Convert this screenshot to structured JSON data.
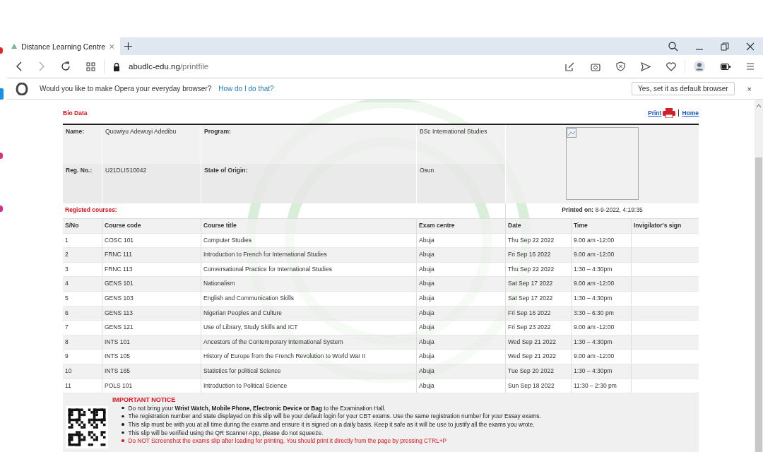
{
  "browser": {
    "tab": {
      "title": "Distance Learning Centre",
      "selected": true
    },
    "url": {
      "domain": "abudlc-edu.ng",
      "path": "/printfile"
    },
    "infobar": {
      "message": "Would you like to make Opera your everyday browser?",
      "link": "How do I do that?",
      "button": "Yes, set it as default browser",
      "close": "×"
    }
  },
  "page": {
    "bio_title": "Bio Data",
    "print_link": "Print",
    "home_link": "Home",
    "bio": [
      {
        "label": "Name:",
        "value": "Quowiyu Adewuyi Adedibu",
        "label2": "Program:",
        "value2": "BSc International Studies"
      },
      {
        "label": "Reg. No.:",
        "value": "U21DLIS10042",
        "label2": "State of Origin:",
        "value2": "Osun"
      }
    ],
    "courses_title": "Registed courses:",
    "printed_label": "Printed on:",
    "printed_value": "8-9-2022, 4:19:35",
    "columns": [
      "S/No",
      "Course code",
      "Course title",
      "Exam centre",
      "Date",
      "Time",
      "Invigilator's sign"
    ],
    "rows": [
      [
        "1",
        "COSC 101",
        "Computer Studies",
        "Abuja",
        "Thu Sep 22 2022",
        "9.00 am -12:00"
      ],
      [
        "2",
        "FRNC 111",
        "Introduction to French for International Studies",
        "Abuja",
        "Fri Sep 16 2022",
        "9.00 am -12:00"
      ],
      [
        "3",
        "FRNC 113",
        "Conversational Practice for International Studies",
        "Abuja",
        "Thu Sep 22 2022",
        "1:30 – 4:30pm"
      ],
      [
        "4",
        "GENS 101",
        "Nationalism",
        "Abuja",
        "Sat Sep 17 2022",
        "9.00 am -12:00"
      ],
      [
        "5",
        "GENS 103",
        "English and Communication Skills",
        "Abuja",
        "Sat Sep 17 2022",
        "1:30 – 4:30pm"
      ],
      [
        "6",
        "GENS 113",
        "Nigerian Peoples and Culture",
        "Abuja",
        "Fri Sep 16 2022",
        "3:30 – 6:30 pm"
      ],
      [
        "7",
        "GENS 121",
        "Use of Library, Study Skills and ICT",
        "Abuja",
        "Fri Sep 23 2022",
        "9.00 am -12:00"
      ],
      [
        "8",
        "INTS 101",
        "Ancestors of the Contemporary International System",
        "Abuja",
        "Wed Sep 21 2022",
        "1:30 – 4:30pm"
      ],
      [
        "9",
        "INTS 105",
        "History of Europe from the French Revolution to World War II",
        "Abuja",
        "Wed Sep 21 2022",
        "9.00 am -12:00"
      ],
      [
        "10",
        "INTS 165",
        "Statistics for political Science",
        "Abuja",
        "Tue Sep 20 2022",
        "1:30 – 4:30pm"
      ],
      [
        "11",
        "POLS 101",
        "Introduction to Political Science",
        "Abuja",
        "Sun Sep 18 2022",
        "11:30 – 2:30 pm"
      ]
    ],
    "notice": {
      "title": "IMPORTANT NOTICE",
      "items": [
        {
          "kind": "normal",
          "text": "Do not bring your **Wrist Watch, Mobile Phone, Electronic Device or Bag** to the Examination Hall."
        },
        {
          "kind": "normal",
          "text": "The registration number and state displayed on this slip will be your default login for your CBT exams. Use the same registration number for your Essay exams."
        },
        {
          "kind": "normal",
          "text": "This slip must be with you at all time during the exams and ensure it is signed on a daily basis. Keep it safe as it will be use to justify all the exams you wrote."
        },
        {
          "kind": "normal",
          "text": "This slip will be verified using the QR Scanner App, please do not squeeze."
        },
        {
          "kind": "warning",
          "text": "Do NOT Screenshot the exams slip after loading for printing. You should print it directly from the page by pressing CTRL+P"
        }
      ]
    }
  }
}
